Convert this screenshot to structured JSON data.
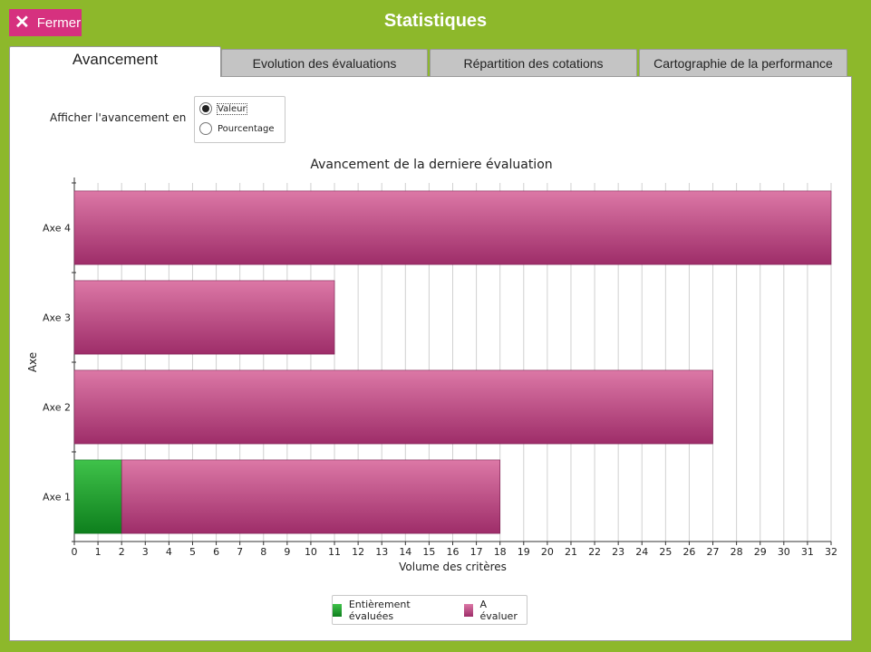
{
  "header": {
    "close_label": "Fermer",
    "title": "Statistiques"
  },
  "tabs": [
    {
      "label": "Avancement",
      "active": true
    },
    {
      "label": "Evolution des évaluations",
      "active": false
    },
    {
      "label": "Répartition des cotations",
      "active": false
    },
    {
      "label": "Cartographie de la performance",
      "active": false
    }
  ],
  "options": {
    "label": "Afficher l'avancement en",
    "choices": [
      {
        "label": "Valeur",
        "selected": true
      },
      {
        "label": "Pourcentage",
        "selected": false
      }
    ]
  },
  "colors": {
    "frame": "#8db82b",
    "close_button": "#d6317f",
    "evaluated": "#1fa83a",
    "to_evaluate": "#c9558f"
  },
  "chart_data": {
    "type": "bar",
    "orientation": "horizontal",
    "stacked": true,
    "title": "Avancement de la derniere évaluation",
    "xlabel": "Volume des critères",
    "ylabel": "Axe",
    "categories": [
      "Axe 1",
      "Axe 2",
      "Axe 3",
      "Axe 4"
    ],
    "series": [
      {
        "name": "Entièrement évaluées",
        "values": [
          2,
          0,
          0,
          0
        ]
      },
      {
        "name": "A évaluer",
        "values": [
          16,
          27,
          11,
          32
        ]
      }
    ],
    "xlim": [
      0,
      32
    ],
    "xticks": [
      "0",
      "1",
      "2",
      "3",
      "4",
      "5",
      "6",
      "7",
      "8",
      "9",
      "10",
      "11",
      "12",
      "13",
      "14",
      "15",
      "16",
      "17",
      "18",
      "19",
      "20",
      "21",
      "22",
      "23",
      "24",
      "25",
      "26",
      "27",
      "28",
      "29",
      "30",
      "31",
      "32"
    ],
    "grid": true,
    "legend_position": "bottom"
  }
}
